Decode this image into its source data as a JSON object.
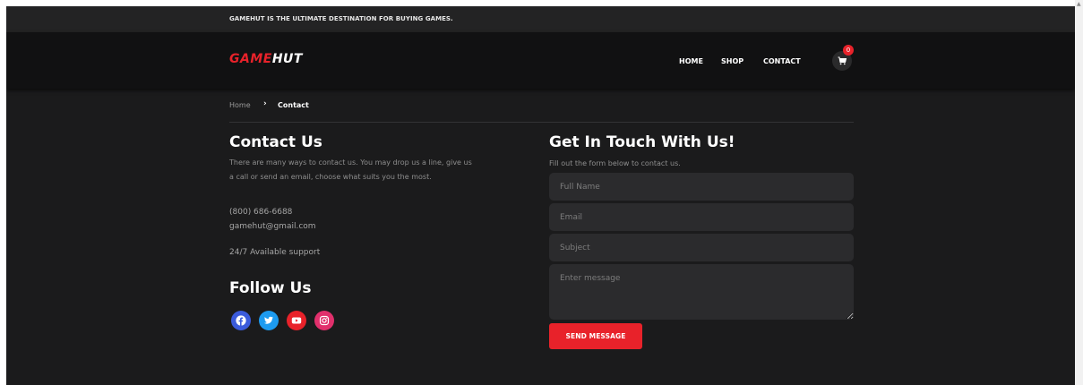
{
  "topbar": {
    "text": "GAMEHUT IS THE ULTIMATE DESTINATION FOR BUYING GAMES."
  },
  "header": {
    "logo_part1": "GAME",
    "logo_part2": "HUT",
    "nav": [
      "HOME",
      "SHOP",
      "CONTACT"
    ],
    "cart_count": "0",
    "cart_icon": "cart-icon"
  },
  "breadcrumb": {
    "home": "Home",
    "separator": "›",
    "current": "Contact"
  },
  "contact": {
    "title": "Contact Us",
    "description_line1": "There are many ways to contact us. You may drop us a line, give us",
    "description_line2": "a call or send an email, choose what suits you the most.",
    "phone": "(800) 686-6688",
    "email": "gamehut@gmail.com",
    "support": "24/7 Available support",
    "follow_title": "Follow Us",
    "social": [
      {
        "icon": "facebook-icon",
        "color": "#3b5bdb"
      },
      {
        "icon": "twitter-icon",
        "color": "#1d9bf0"
      },
      {
        "icon": "youtube-icon",
        "color": "#e8222a"
      },
      {
        "icon": "instagram-icon",
        "color": "#e1306c"
      }
    ]
  },
  "form": {
    "title": "Get In Touch With Us!",
    "subtitle": "Fill out the form below to contact us.",
    "fullname_placeholder": "Full Name",
    "email_placeholder": "Email",
    "subject_placeholder": "Subject",
    "message_placeholder": "Enter message",
    "submit_label": "SEND MESSAGE"
  },
  "colors": {
    "accent": "#e8222a",
    "background": "#1b1b1c",
    "header": "#111112"
  }
}
